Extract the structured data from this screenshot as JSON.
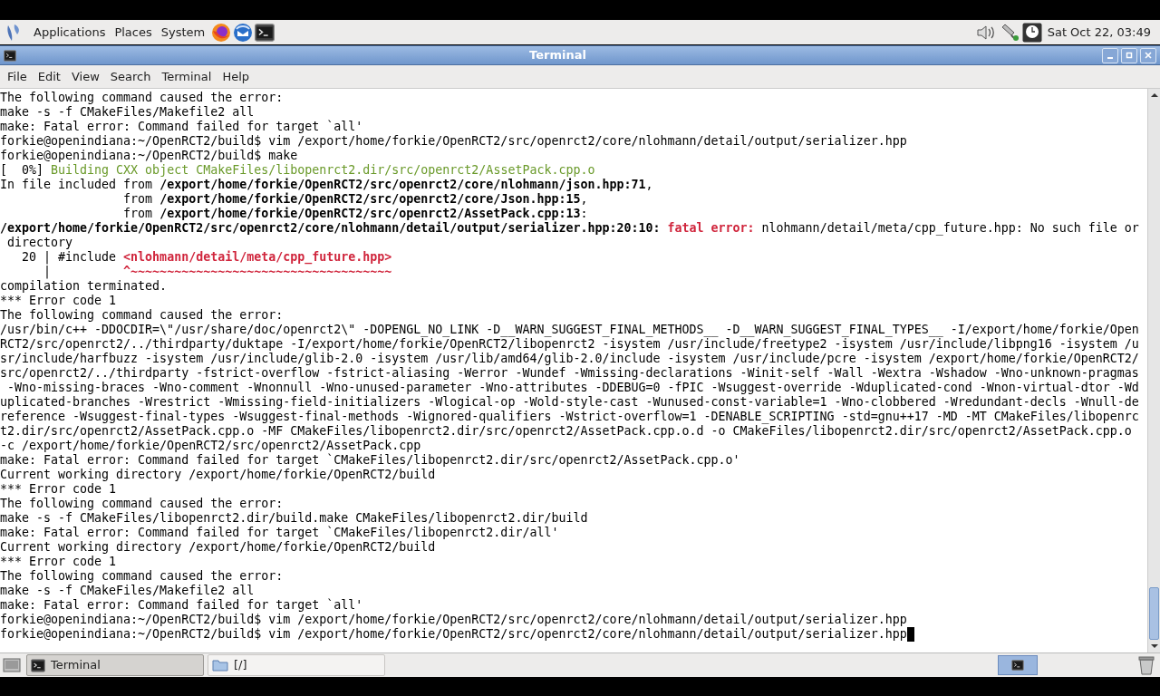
{
  "top_panel": {
    "menus": [
      {
        "label": "Applications"
      },
      {
        "label": "Places"
      },
      {
        "label": "System"
      }
    ],
    "clock": "Sat Oct 22, 03:49"
  },
  "window": {
    "title": "Terminal"
  },
  "menu_bar": [
    {
      "label": "File"
    },
    {
      "label": "Edit"
    },
    {
      "label": "View"
    },
    {
      "label": "Search"
    },
    {
      "label": "Terminal"
    },
    {
      "label": "Help"
    }
  ],
  "terminal": {
    "cursor_visible": true,
    "lines": [
      [
        {
          "kind": "plain",
          "text": "The following command caused the error:"
        }
      ],
      [
        {
          "kind": "plain",
          "text": "make -s -f CMakeFiles/Makefile2 all"
        }
      ],
      [
        {
          "kind": "plain",
          "text": "make: Fatal error: Command failed for target `all'"
        }
      ],
      [
        {
          "kind": "plain",
          "text": "forkie@openindiana:~/OpenRCT2/build$ vim /export/home/forkie/OpenRCT2/src/openrct2/core/nlohmann/detail/output/serializer.hpp"
        }
      ],
      [
        {
          "kind": "plain",
          "text": "forkie@openindiana:~/OpenRCT2/build$ make"
        }
      ],
      [
        {
          "kind": "plain",
          "text": "[  0%] "
        },
        {
          "kind": "green",
          "text": "Building CXX object CMakeFiles/libopenrct2.dir/src/openrct2/AssetPack.cpp.o"
        }
      ],
      [
        {
          "kind": "plain",
          "text": "In file included from "
        },
        {
          "kind": "bold",
          "text": "/export/home/forkie/OpenRCT2/src/openrct2/core/nlohmann/json.hpp:71"
        },
        {
          "kind": "plain",
          "text": ","
        }
      ],
      [
        {
          "kind": "plain",
          "text": "                 from "
        },
        {
          "kind": "bold",
          "text": "/export/home/forkie/OpenRCT2/src/openrct2/core/Json.hpp:15"
        },
        {
          "kind": "plain",
          "text": ","
        }
      ],
      [
        {
          "kind": "plain",
          "text": "                 from "
        },
        {
          "kind": "bold",
          "text": "/export/home/forkie/OpenRCT2/src/openrct2/AssetPack.cpp:13"
        },
        {
          "kind": "plain",
          "text": ":"
        }
      ],
      [
        {
          "kind": "bold",
          "text": "/export/home/forkie/OpenRCT2/src/openrct2/core/nlohmann/detail/output/serializer.hpp:20:10:"
        },
        {
          "kind": "red_bold",
          "text": " fatal error:"
        },
        {
          "kind": "plain",
          "text": " nlohmann/detail/meta/cpp_future.hpp: No such file or"
        }
      ],
      [
        {
          "kind": "plain",
          "text": " directory"
        }
      ],
      [
        {
          "kind": "plain",
          "text": "   20 | #include "
        },
        {
          "kind": "red_bold",
          "text": "<nlohmann/detail/meta/cpp_future.hpp>"
        }
      ],
      [
        {
          "kind": "plain",
          "text": "      |          "
        },
        {
          "kind": "red_bold",
          "text": "^~~~~~~~~~~~~~~~~~~~~~~~~~~~~~~~~~~~~"
        }
      ],
      [
        {
          "kind": "plain",
          "text": "compilation terminated."
        }
      ],
      [
        {
          "kind": "plain",
          "text": "*** Error code 1"
        }
      ],
      [
        {
          "kind": "plain",
          "text": "The following command caused the error:"
        }
      ],
      [
        {
          "kind": "plain",
          "text": "/usr/bin/c++ -DDOCDIR=\\\"/usr/share/doc/openrct2\\\" -DOPENGL_NO_LINK -D__WARN_SUGGEST_FINAL_METHODS__ -D__WARN_SUGGEST_FINAL_TYPES__ -I/export/home/forkie/Open"
        }
      ],
      [
        {
          "kind": "plain",
          "text": "RCT2/src/openrct2/../thirdparty/duktape -I/export/home/forkie/OpenRCT2/libopenrct2 -isystem /usr/include/freetype2 -isystem /usr/include/libpng16 -isystem /u"
        }
      ],
      [
        {
          "kind": "plain",
          "text": "sr/include/harfbuzz -isystem /usr/include/glib-2.0 -isystem /usr/lib/amd64/glib-2.0/include -isystem /usr/include/pcre -isystem /export/home/forkie/OpenRCT2/"
        }
      ],
      [
        {
          "kind": "plain",
          "text": "src/openrct2/../thirdparty -fstrict-overflow -fstrict-aliasing -Werror -Wundef -Wmissing-declarations -Winit-self -Wall -Wextra -Wshadow -Wno-unknown-pragmas"
        }
      ],
      [
        {
          "kind": "plain",
          "text": " -Wno-missing-braces -Wno-comment -Wnonnull -Wno-unused-parameter -Wno-attributes -DDEBUG=0 -fPIC -Wsuggest-override -Wduplicated-cond -Wnon-virtual-dtor -Wd"
        }
      ],
      [
        {
          "kind": "plain",
          "text": "uplicated-branches -Wrestrict -Wmissing-field-initializers -Wlogical-op -Wold-style-cast -Wunused-const-variable=1 -Wno-clobbered -Wredundant-decls -Wnull-de"
        }
      ],
      [
        {
          "kind": "plain",
          "text": "reference -Wsuggest-final-types -Wsuggest-final-methods -Wignored-qualifiers -Wstrict-overflow=1 -DENABLE_SCRIPTING -std=gnu++17 -MD -MT CMakeFiles/libopenrc"
        }
      ],
      [
        {
          "kind": "plain",
          "text": "t2.dir/src/openrct2/AssetPack.cpp.o -MF CMakeFiles/libopenrct2.dir/src/openrct2/AssetPack.cpp.o.d -o CMakeFiles/libopenrct2.dir/src/openrct2/AssetPack.cpp.o"
        }
      ],
      [
        {
          "kind": "plain",
          "text": "-c /export/home/forkie/OpenRCT2/src/openrct2/AssetPack.cpp"
        }
      ],
      [
        {
          "kind": "plain",
          "text": "make: Fatal error: Command failed for target `CMakeFiles/libopenrct2.dir/src/openrct2/AssetPack.cpp.o'"
        }
      ],
      [
        {
          "kind": "plain",
          "text": "Current working directory /export/home/forkie/OpenRCT2/build"
        }
      ],
      [
        {
          "kind": "plain",
          "text": "*** Error code 1"
        }
      ],
      [
        {
          "kind": "plain",
          "text": "The following command caused the error:"
        }
      ],
      [
        {
          "kind": "plain",
          "text": "make -s -f CMakeFiles/libopenrct2.dir/build.make CMakeFiles/libopenrct2.dir/build"
        }
      ],
      [
        {
          "kind": "plain",
          "text": "make: Fatal error: Command failed for target `CMakeFiles/libopenrct2.dir/all'"
        }
      ],
      [
        {
          "kind": "plain",
          "text": "Current working directory /export/home/forkie/OpenRCT2/build"
        }
      ],
      [
        {
          "kind": "plain",
          "text": "*** Error code 1"
        }
      ],
      [
        {
          "kind": "plain",
          "text": "The following command caused the error:"
        }
      ],
      [
        {
          "kind": "plain",
          "text": "make -s -f CMakeFiles/Makefile2 all"
        }
      ],
      [
        {
          "kind": "plain",
          "text": "make: Fatal error: Command failed for target `all'"
        }
      ],
      [
        {
          "kind": "plain",
          "text": "forkie@openindiana:~/OpenRCT2/build$ vim /export/home/forkie/OpenRCT2/src/openrct2/core/nlohmann/detail/output/serializer.hpp"
        }
      ],
      [
        {
          "kind": "plain",
          "text": "forkie@openindiana:~/OpenRCT2/build$ vim /export/home/forkie/OpenRCT2/src/openrct2/core/nlohmann/detail/output/serializer.hpp"
        }
      ]
    ]
  },
  "taskbar": [
    {
      "label": "Terminal",
      "selected": true,
      "kind": "terminal"
    },
    {
      "label": "[/]",
      "selected": false,
      "kind": "folder"
    }
  ]
}
